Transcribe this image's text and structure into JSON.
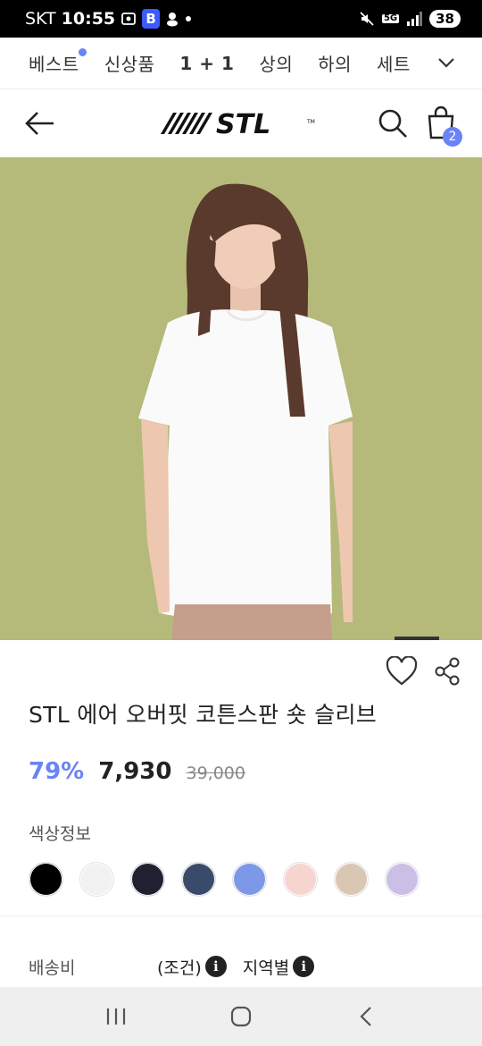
{
  "status_bar": {
    "carrier": "SKT",
    "time": "10:55",
    "network": "5G",
    "battery": "38"
  },
  "categories": [
    {
      "label": "베스트",
      "dot": true
    },
    {
      "label": "신상품",
      "dot": false
    },
    {
      "label": "1 + 1",
      "dot": false
    },
    {
      "label": "상의",
      "dot": false
    },
    {
      "label": "하의",
      "dot": false
    },
    {
      "label": "세트",
      "dot": false
    }
  ],
  "header": {
    "logo_text": "STL",
    "cart_count": "2"
  },
  "product": {
    "title": "STL 에어 오버핏 코튼스판 숏 슬리브",
    "discount": "79%",
    "price": "7,930",
    "original_price": "39,000",
    "color_label": "색상정보",
    "swatches": [
      "#000000",
      "#f2f2f2",
      "#1f2130",
      "#3a4a6a",
      "#7d98e6",
      "#f6d4d0",
      "#d9c7b4",
      "#cbbfe6"
    ]
  },
  "shipping": {
    "label": "배송비",
    "condition": "(조건)",
    "region": "지역별"
  },
  "colors": {
    "accent": "#6a84f4",
    "hero_background": "#b5b97a"
  }
}
